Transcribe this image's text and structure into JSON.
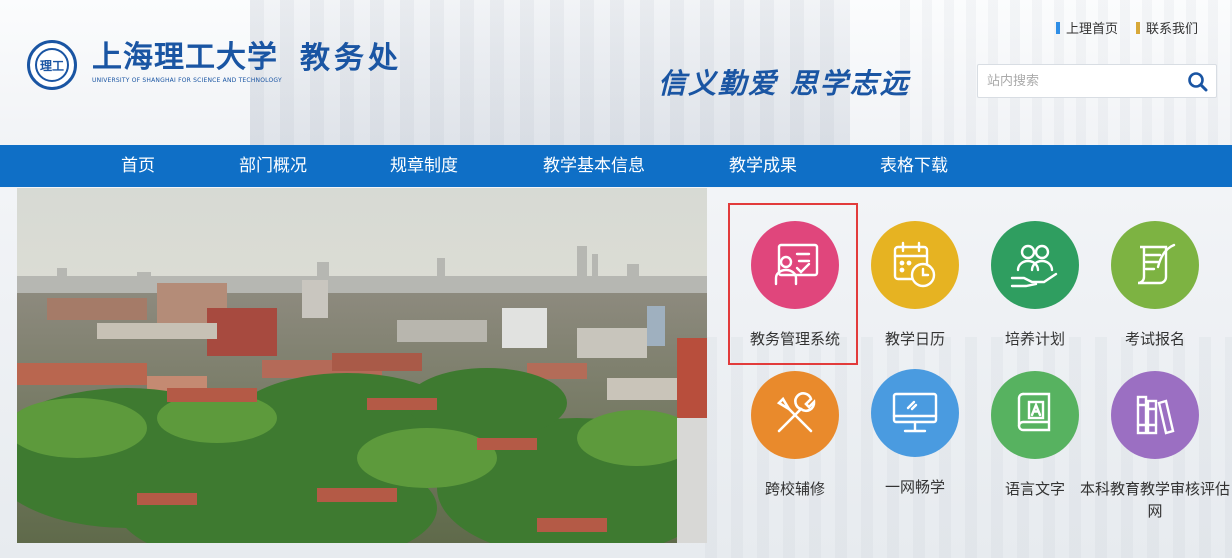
{
  "header": {
    "logo_seal_text": "理工",
    "logo_name": "上海理工大学",
    "logo_en": "UNIVERSITY OF SHANGHAI FOR SCIENCE AND TECHNOLOGY",
    "dept": "教务处",
    "motto": "信义勤爱 思学志远",
    "links": [
      {
        "label": "上理首页",
        "color": "#2f8ee6"
      },
      {
        "label": "联系我们",
        "color": "#d8a93a"
      }
    ],
    "search_placeholder": "站内搜索"
  },
  "nav": {
    "items": [
      {
        "label": "首页"
      },
      {
        "label": "部门概况"
      },
      {
        "label": "规章制度"
      },
      {
        "label": "教学基本信息"
      },
      {
        "label": "教学成果"
      },
      {
        "label": "表格下载"
      }
    ]
  },
  "quicklinks": [
    {
      "label": "教务管理系统",
      "color": "#e0467c",
      "icon": "teacher-board-icon"
    },
    {
      "label": "教学日历",
      "color": "#e6b322",
      "icon": "calendar-clock-icon"
    },
    {
      "label": "培养计划",
      "color": "#2f9e60",
      "icon": "people-hand-icon"
    },
    {
      "label": "考试报名",
      "color": "#7db342",
      "icon": "scroll-quill-icon"
    },
    {
      "label": "跨校辅修",
      "color": "#e98a2c",
      "icon": "tools-icon"
    },
    {
      "label": "一网畅学",
      "color": "#4a9be0",
      "icon": "monitor-icon"
    },
    {
      "label": "语言文字",
      "color": "#57b260",
      "icon": "dictionary-icon"
    },
    {
      "label": "本科教育教学审核评估网",
      "color": "#9b6fc2",
      "icon": "books-icon"
    }
  ],
  "colors": {
    "nav_bg": "#0f6fc6",
    "brand_blue": "#1a55a3",
    "highlight": "#e23b3b"
  }
}
